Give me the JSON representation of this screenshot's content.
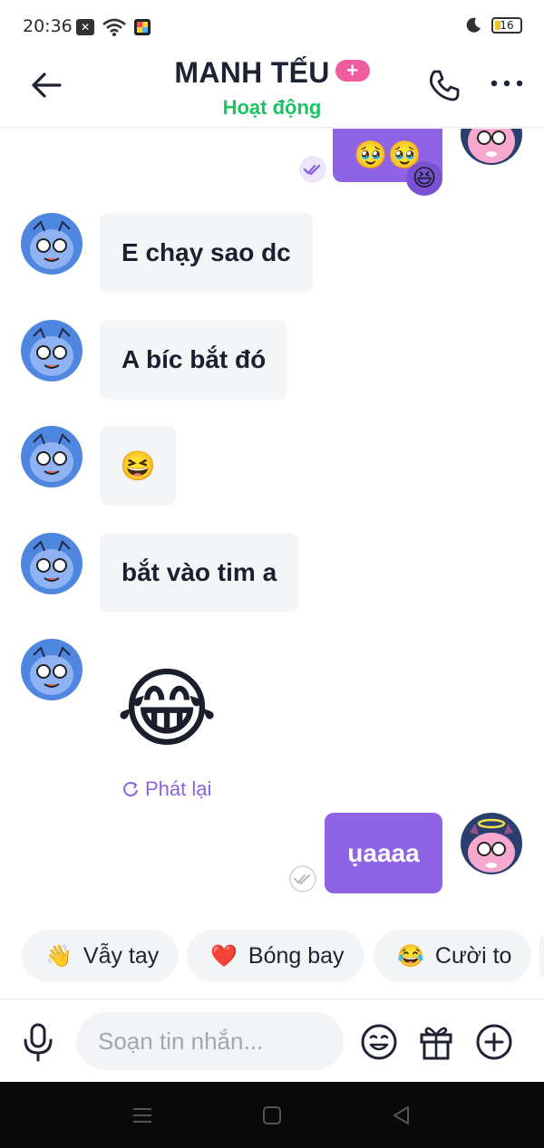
{
  "status_bar": {
    "time": "20:36",
    "battery": "16",
    "icons": [
      "notification-x-icon",
      "wifi-icon",
      "app-icon",
      "moon-icon",
      "battery-icon"
    ]
  },
  "header": {
    "contact_name": "MANH TẾU",
    "plus_badge": "+",
    "status": "Hoạt động",
    "status_color": "#19c462",
    "icons": [
      "back-arrow-icon",
      "phone-icon",
      "more-icon"
    ]
  },
  "messages": [
    {
      "direction": "out",
      "type": "emoji",
      "text": "🥹🥹",
      "reaction": "😆"
    },
    {
      "direction": "in",
      "type": "text",
      "text": "E chạy sao dc"
    },
    {
      "direction": "in",
      "type": "text",
      "text": "A bíc bắt đó"
    },
    {
      "direction": "in",
      "type": "emoji",
      "text": "😆"
    },
    {
      "direction": "in",
      "type": "text",
      "text": "bắt vào tim a"
    },
    {
      "direction": "in",
      "type": "sticker",
      "text": "😂",
      "replay_label": "Phát lại"
    },
    {
      "direction": "out",
      "type": "text",
      "text": "ụaaaa"
    }
  ],
  "quick_reactions": [
    {
      "emoji": "👋",
      "label": "Vẫy tay"
    },
    {
      "emoji": "❤️",
      "label": "Bóng bay"
    },
    {
      "emoji": "😂",
      "label": "Cười to"
    }
  ],
  "composer": {
    "placeholder": "Soạn tin nhắn...",
    "value": ""
  },
  "colors": {
    "accent": "#8f63e6",
    "incoming_bubble": "#f4f5f7",
    "badge": "#ee5d9f"
  }
}
